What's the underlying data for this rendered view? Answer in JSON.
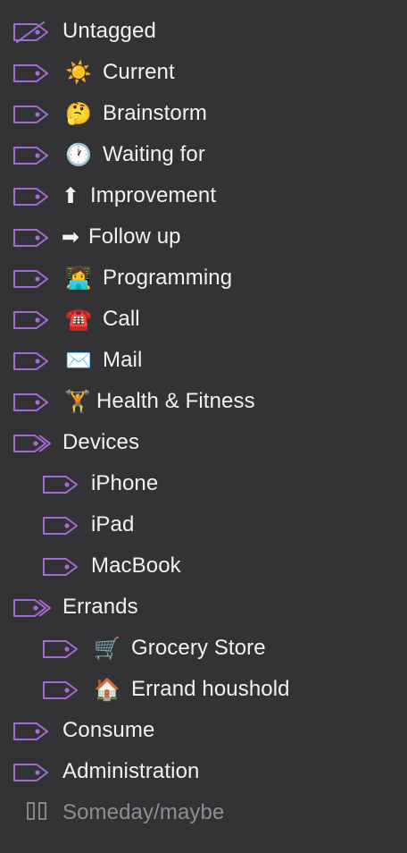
{
  "colors": {
    "background": "#333336",
    "text": "#f2f2f4",
    "muted_text": "#8e8e93",
    "tag_icon": "#a46ad6",
    "pause_icon": "#8e8e93"
  },
  "tags": [
    {
      "label": "Untagged",
      "emoji": "",
      "icon": "untagged-icon"
    },
    {
      "label": "Current",
      "emoji": "☀️",
      "icon": "tag-icon"
    },
    {
      "label": "Brainstorm",
      "emoji": "🤔",
      "icon": "tag-icon"
    },
    {
      "label": "Waiting for",
      "emoji": "🕐",
      "icon": "tag-icon"
    },
    {
      "label": "Improvement",
      "emoji": "⬆",
      "icon": "tag-icon"
    },
    {
      "label": "Follow up",
      "emoji": "➡",
      "icon": "tag-icon"
    },
    {
      "label": "Programming",
      "emoji": "👩‍💻",
      "icon": "tag-icon"
    },
    {
      "label": "Call",
      "emoji": "☎️",
      "icon": "tag-icon"
    },
    {
      "label": "Mail",
      "emoji": "✉️",
      "icon": "tag-icon"
    },
    {
      "label": "Health & Fitness",
      "emoji": "🏋",
      "icon": "tag-icon"
    },
    {
      "label": "Devices",
      "emoji": "",
      "icon": "tag-group-icon"
    },
    {
      "label": "iPhone",
      "emoji": "",
      "icon": "tag-icon"
    },
    {
      "label": "iPad",
      "emoji": "",
      "icon": "tag-icon"
    },
    {
      "label": "MacBook",
      "emoji": "",
      "icon": "tag-icon"
    },
    {
      "label": "Errands",
      "emoji": "",
      "icon": "tag-group-icon"
    },
    {
      "label": "Grocery Store",
      "emoji": "🛒",
      "icon": "tag-icon"
    },
    {
      "label": "Errand houshold",
      "emoji": "🏠",
      "icon": "tag-icon"
    },
    {
      "label": "Consume",
      "emoji": "",
      "icon": "tag-icon"
    },
    {
      "label": "Administration",
      "emoji": "",
      "icon": "tag-icon"
    },
    {
      "label": "Someday/maybe",
      "emoji": "",
      "icon": "pause-icon"
    }
  ]
}
